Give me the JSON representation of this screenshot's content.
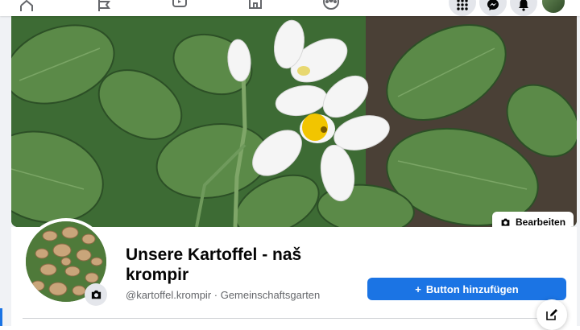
{
  "nav": {
    "icons": [
      "home-icon",
      "flag-icon",
      "video-icon",
      "marketplace-icon",
      "groups-icon"
    ],
    "right_buttons": [
      "menu-grid-icon",
      "messenger-icon",
      "notifications-icon"
    ],
    "accent_color": "#1b74e4"
  },
  "cover": {
    "edit_label": "Bearbeiten"
  },
  "profile": {
    "name": "Unsere Kartoffel - naš krompir",
    "subtitle": "@kartoffel.krompir · Gemeinschaftsgarten",
    "add_button_label": "Button hinzufügen"
  },
  "colors": {
    "button_blue": "#1b74e4",
    "secondary_text": "#65676b",
    "page_background": "#f0f2f5"
  }
}
